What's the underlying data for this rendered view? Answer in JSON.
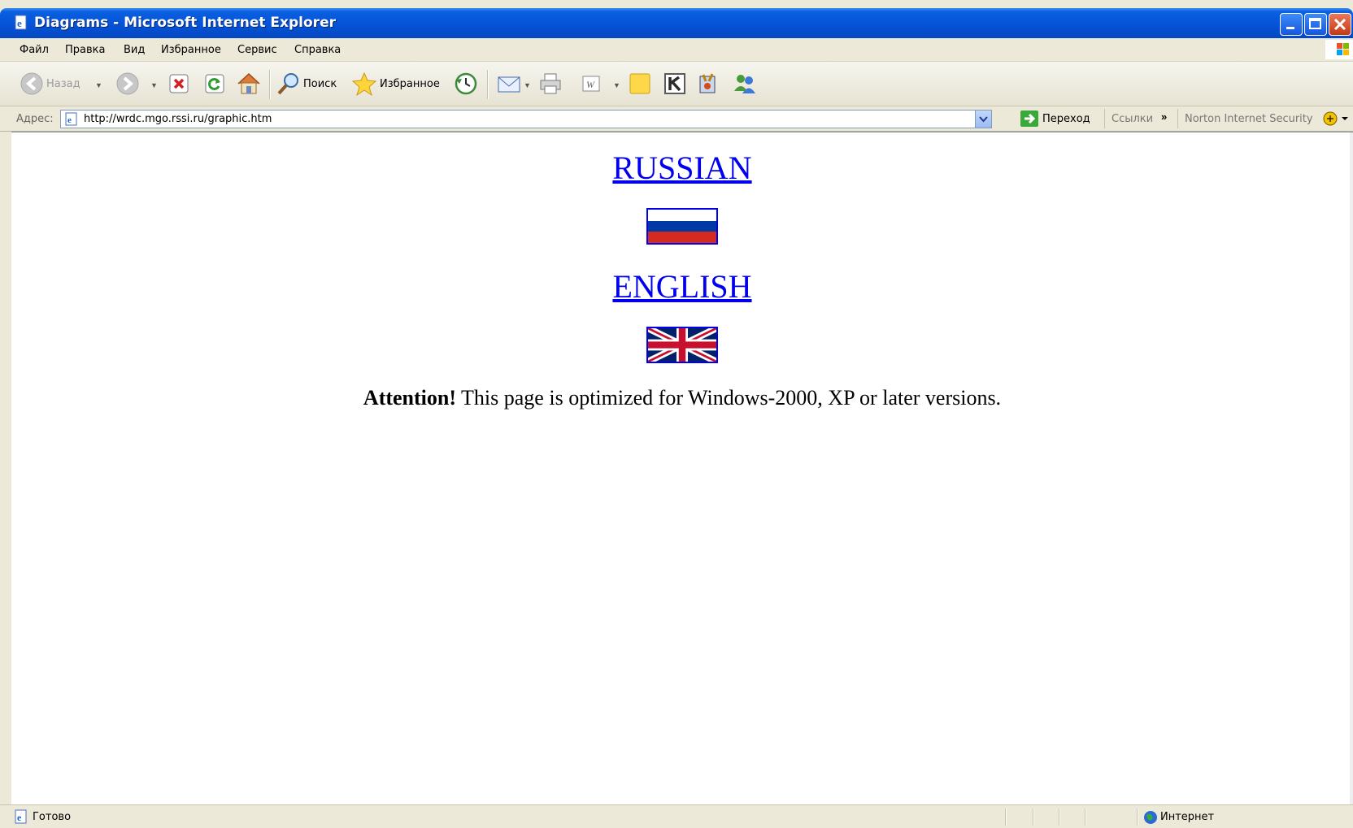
{
  "window": {
    "title": "Diagrams - Microsoft Internet Explorer"
  },
  "menu": {
    "items": [
      "Файл",
      "Правка",
      "Вид",
      "Избранное",
      "Сервис",
      "Справка"
    ]
  },
  "toolbar": {
    "back_label": "Назад",
    "search_label": "Поиск",
    "favorites_label": "Избранное"
  },
  "address_bar": {
    "label": "Адрес:",
    "url": "http://wrdc.mgo.rssi.ru/graphic.htm",
    "go_label": "Переход",
    "links_label": "Ссылки",
    "chevron": "»",
    "norton_label": "Norton Internet Security"
  },
  "page": {
    "russian_link": "RUSSIAN",
    "english_link": "ENGLISH",
    "attention_bold": "Attention!",
    "attention_text": " This page is optimized for Windows-2000, XP or later versions."
  },
  "status_bar": {
    "status": "Готово",
    "zone": "Интернет"
  },
  "colors": {
    "link": "#0000ee",
    "titlebar": "#0553d8",
    "flag_ru_white": "#ffffff",
    "flag_ru_blue": "#0039a6",
    "flag_ru_red": "#d52b1e",
    "flag_uk_blue": "#012169",
    "flag_uk_red": "#c8102e"
  }
}
